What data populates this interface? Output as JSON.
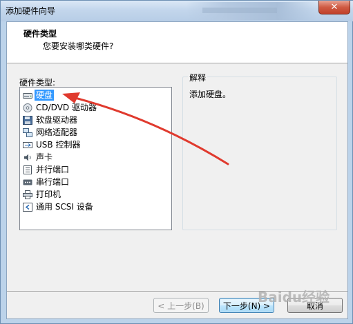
{
  "window": {
    "title": "添加硬件向导",
    "close_glyph": "✕"
  },
  "header": {
    "title": "硬件类型",
    "subtitle": "您要安装哪类硬件?"
  },
  "list": {
    "label": "硬件类型:",
    "items": [
      {
        "label": "硬盘",
        "icon": "hard-disk-icon",
        "selected": true
      },
      {
        "label": "CD/DVD 驱动器",
        "icon": "cd-dvd-icon"
      },
      {
        "label": "软盘驱动器",
        "icon": "floppy-icon"
      },
      {
        "label": "网络适配器",
        "icon": "network-adapter-icon"
      },
      {
        "label": "USB 控制器",
        "icon": "usb-icon"
      },
      {
        "label": "声卡",
        "icon": "sound-card-icon"
      },
      {
        "label": "并行端口",
        "icon": "parallel-port-icon"
      },
      {
        "label": "串行端口",
        "icon": "serial-port-icon"
      },
      {
        "label": "打印机",
        "icon": "printer-icon"
      },
      {
        "label": "通用 SCSI 设备",
        "icon": "scsi-icon"
      }
    ]
  },
  "explain": {
    "legend": "解释",
    "text": "添加硬盘。"
  },
  "buttons": {
    "back": "< 上一步(B)",
    "next": "下一步(N) >",
    "cancel": "取消"
  },
  "annotation": {
    "arrow_color": "#e03a2e"
  },
  "watermark": {
    "text": "Baidu经验"
  }
}
